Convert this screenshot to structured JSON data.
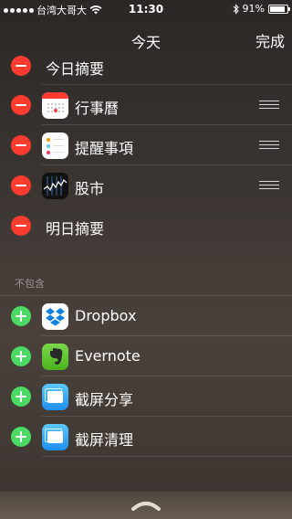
{
  "status_bar": {
    "carrier": "台湾大哥大",
    "time": "11:30",
    "battery_text": "91%",
    "battery_level": 0.91,
    "signal_bars": 5
  },
  "nav": {
    "title": "今天",
    "done_label": "完成"
  },
  "included": [
    {
      "label": "今日摘要",
      "icon": "none",
      "reorderable": false
    },
    {
      "label": "行事曆",
      "icon": "calendar-icon",
      "reorderable": true
    },
    {
      "label": "提醒事項",
      "icon": "reminders-icon",
      "reorderable": true
    },
    {
      "label": "股市",
      "icon": "stocks-icon",
      "reorderable": true
    },
    {
      "label": "明日摘要",
      "icon": "none",
      "reorderable": false
    }
  ],
  "excluded_header": "不包含",
  "excluded": [
    {
      "label": "Dropbox",
      "icon": "dropbox-icon"
    },
    {
      "label": "Evernote",
      "icon": "evernote-icon"
    },
    {
      "label": "截屏分享",
      "icon": "screenshot-icon"
    },
    {
      "label": "截屏清理",
      "icon": "screenshot-icon"
    }
  ],
  "colors": {
    "delete": "#ff3b30",
    "add": "#4cd964"
  }
}
